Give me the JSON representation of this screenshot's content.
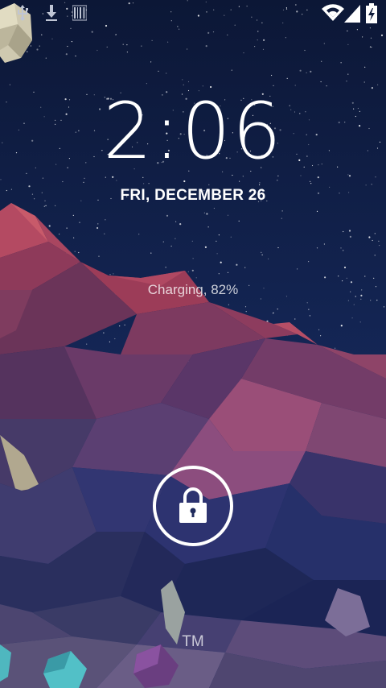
{
  "status_bar": {
    "left_icons": [
      "usb-icon",
      "download-icon",
      "barcode-icon"
    ],
    "right_icons": [
      "wifi-icon",
      "signal-icon",
      "battery-charging-icon"
    ]
  },
  "lockscreen": {
    "time": "2:06",
    "date": "FRI, DECEMBER 26",
    "charging_status": "Charging, 82%",
    "carrier": "TM",
    "unlock_icon": "lock-icon"
  },
  "colors": {
    "sky": "#0e1a3a",
    "text": "#ffffff"
  }
}
